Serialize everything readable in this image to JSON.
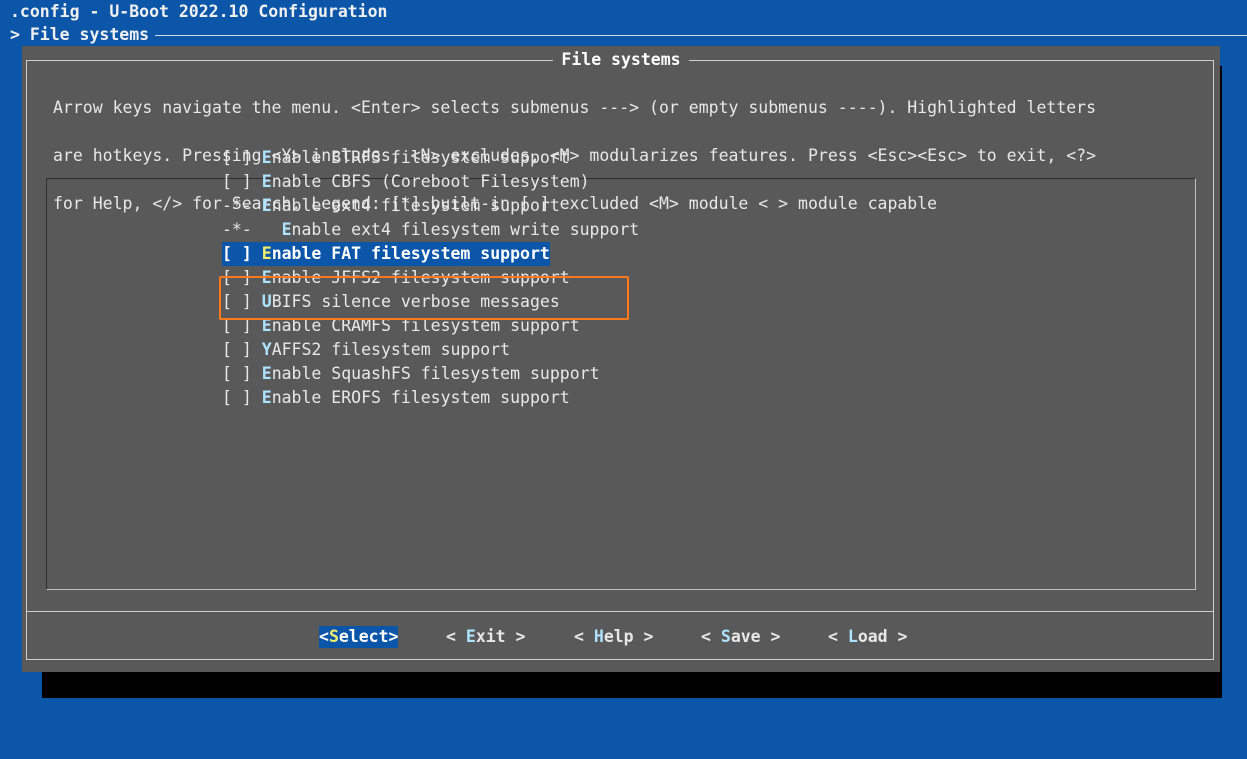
{
  "window": {
    "title": ".config - U-Boot 2022.10 Configuration",
    "breadcrumb": "> File systems"
  },
  "dialog": {
    "title": "File systems",
    "help_lines": [
      "Arrow keys navigate the menu.  <Enter> selects submenus ---> (or empty submenus ----).  Highlighted letters",
      "are hotkeys.  Pressing <Y> includes, <N> excludes, <M> modularizes features.  Press <Esc><Esc> to exit, <?>",
      "for Help, </> for Search.  Legend: [*] built-in  [ ] excluded  <M> module  < > module capable"
    ]
  },
  "menu": {
    "items": [
      {
        "prefix": "[ ] ",
        "hotkey": "E",
        "rest": "nable BTRFS filesystem support"
      },
      {
        "prefix": "[ ] ",
        "hotkey": "E",
        "rest": "nable CBFS (Coreboot Filesystem)"
      },
      {
        "prefix": "-*- ",
        "hotkey": "E",
        "rest": "nable ext4 filesystem support"
      },
      {
        "prefix": "-*-   ",
        "hotkey": "E",
        "rest": "nable ext4 filesystem write support"
      },
      {
        "prefix": "[ ] ",
        "hotkey": "E",
        "rest": "nable FAT filesystem support",
        "selected": true
      },
      {
        "prefix": "[ ] ",
        "hotkey": "E",
        "rest": "nable JFFS2 filesystem support"
      },
      {
        "prefix": "[ ] ",
        "hotkey": "U",
        "rest": "BIFS silence verbose messages"
      },
      {
        "prefix": "[ ] ",
        "hotkey": "E",
        "rest": "nable CRAMFS filesystem support"
      },
      {
        "prefix": "[ ] ",
        "hotkey": "Y",
        "rest": "AFFS2 filesystem support"
      },
      {
        "prefix": "[ ] ",
        "hotkey": "E",
        "rest": "nable SquashFS filesystem support"
      },
      {
        "prefix": "[ ] ",
        "hotkey": "E",
        "rest": "nable EROFS filesystem support"
      }
    ]
  },
  "buttons": {
    "select": {
      "open": "<",
      "hotkey": "S",
      "rest": "elect>"
    },
    "exit": {
      "open": "< ",
      "hotkey": "E",
      "rest": "xit >"
    },
    "help": {
      "open": "< ",
      "hotkey": "H",
      "rest": "elp >"
    },
    "save": {
      "open": "< ",
      "hotkey": "S",
      "rest": "ave >"
    },
    "load": {
      "open": "< ",
      "hotkey": "L",
      "rest": "oad >"
    }
  },
  "colors": {
    "background": "#0b56a8",
    "dialog": "#595959",
    "highlight": "#0b56a8",
    "hotkey": "#aee3ff",
    "selected_hotkey": "#f4f06a",
    "annotation_box": "#ff7a1a"
  }
}
